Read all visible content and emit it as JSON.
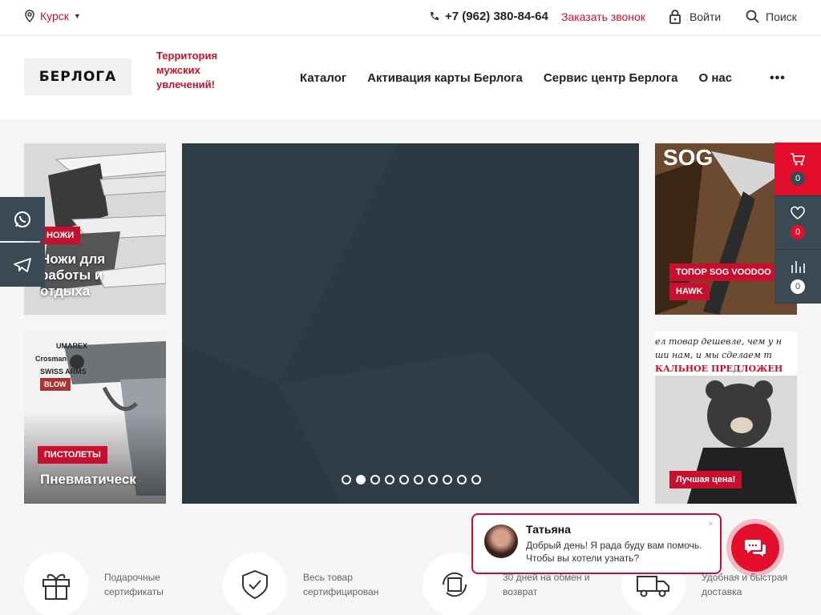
{
  "topbar": {
    "city": "Курск",
    "phone": "+7 (962) 380-84-64",
    "callback": "Заказать звонок",
    "login": "Войти",
    "search": "Поиск"
  },
  "header": {
    "logo_text": "БЕРЛОГА",
    "slogan": "Территория мужских увлечений!",
    "nav": [
      "Каталог",
      "Активация карты Берлога",
      "Сервис центр Берлога",
      "О нас"
    ],
    "more": "•••"
  },
  "tiles": {
    "knives": {
      "tag": "Ножи",
      "title": "Ножи для работы и отдыха"
    },
    "pistols": {
      "tag": "Пистолеты",
      "title": "Пневматическ",
      "brand_lines": [
        "UMAREX",
        "Crosman",
        "SWISS ARMS",
        "BLOW"
      ]
    },
    "sog": {
      "brand": "SOG",
      "tag1": "Топор SOG Voodoo",
      "tag2": "Hawk"
    },
    "bestprice": {
      "promo": [
        "ел товар дешевле, чем у н",
        "ши нам, и мы сделаем т",
        "КАЛЬНОЕ ПРЕДЛОЖЕН"
      ],
      "tag": "Лучшая цена!"
    }
  },
  "slider": {
    "dots": 10,
    "active": 2
  },
  "rail": {
    "cart_count": "0",
    "favorites_count": "0",
    "compare_count": "0"
  },
  "features": [
    {
      "text": "Подарочные сертификаты",
      "icon": "gift-icon"
    },
    {
      "text": "Весь товар сертифицирован",
      "icon": "shield-check-icon"
    },
    {
      "text": "30 дней на обмен и возврат",
      "icon": "return-box-icon"
    },
    {
      "text": "Удобная и быстрая доставка",
      "icon": "truck-icon"
    }
  ],
  "chat": {
    "name": "Татьяна",
    "message": "Добрый день! Я рада буду вам помочь. Чтобы вы хотели узнать?",
    "close": "×"
  },
  "colors": {
    "brand_red": "#c8102e",
    "rail_dark": "#3a4a55",
    "slider_bg": "#2b3a42"
  }
}
